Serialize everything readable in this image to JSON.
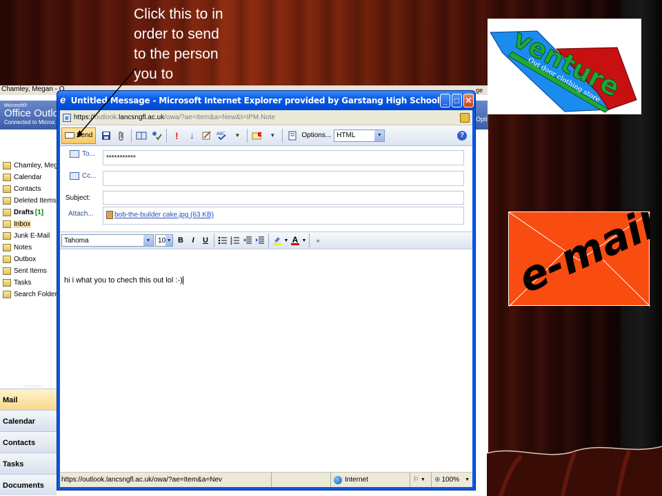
{
  "annotation": {
    "line1": "Click this to in",
    "line2": "order to send",
    "line3": "to the person",
    "line4": "you to"
  },
  "outlook_bg": {
    "title_fragment": "Chamley, Megan - O",
    "top_right_fragment": "ge",
    "header_microsoft": "Microsoft®",
    "header_product": "Office Outlo",
    "header_connected": "Connected to Micros",
    "header_right_fragment": "Opti",
    "folders": [
      {
        "label": "Chamley, Megan",
        "count": ""
      },
      {
        "label": "Calendar",
        "count": ""
      },
      {
        "label": "Contacts",
        "count": ""
      },
      {
        "label": "Deleted Items",
        "count": ""
      },
      {
        "label": "Drafts",
        "count": "[1]"
      },
      {
        "label": "Inbox",
        "count": ""
      },
      {
        "label": "Junk E-Mail",
        "count": ""
      },
      {
        "label": "Notes",
        "count": ""
      },
      {
        "label": "Outbox",
        "count": ""
      },
      {
        "label": "Sent Items",
        "count": ""
      },
      {
        "label": "Tasks",
        "count": ""
      },
      {
        "label": "Search Folders",
        "count": ""
      }
    ],
    "nav_buttons": [
      "Mail",
      "Calendar",
      "Contacts",
      "Tasks",
      "Documents"
    ]
  },
  "ie_window": {
    "title": "Untitled Message - Microsoft Internet Explorer provided by Garstang High School",
    "address_prefix": "https://",
    "address_host_grey": "outlook.",
    "address_host": "lancsngfl.ac.uk",
    "address_path": "/owa/?ae=Item&a=New&t=IPM.Note",
    "toolbar": {
      "send_label": "Send",
      "options_label": "Options...",
      "format_value": "HTML"
    },
    "headers": {
      "to_label": "To...",
      "to_value": "***********",
      "cc_label": "Cc...",
      "cc_value": "",
      "subject_label": "Subject:",
      "subject_value": "",
      "attach_label": "Attach...",
      "attachment": "bob-the-builder cake.jpg (63 KB)"
    },
    "formatting": {
      "font": "Tahoma",
      "size": "10",
      "bold": "B",
      "italic": "I",
      "underline": "U",
      "font_color": "A"
    },
    "body_text": "hi i what you to chech this out lol :-)",
    "status": {
      "url": "https://outlook.lancsngfl.ac.uk/owa/?ae=Item&a=Nev",
      "zone": "Internet",
      "zoom": "100%"
    }
  },
  "logos": {
    "venture_name": "venture",
    "venture_tagline": "Out door clothing store",
    "email_text": "e-mail"
  },
  "colors": {
    "ie_blue": "#0a58e0",
    "email_orange": "#f84c10",
    "venture_blue": "#1a8cf0",
    "venture_red": "#c81010",
    "venture_green": "#20a838"
  }
}
